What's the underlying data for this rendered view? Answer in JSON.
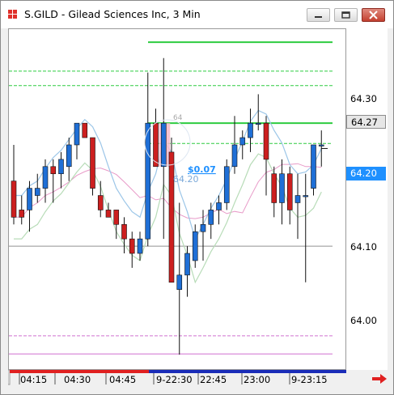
{
  "window": {
    "title": "S.GILD - Gilead Sciences Inc, 3 Min",
    "controls": [
      "minimize",
      "restore",
      "close"
    ]
  },
  "price_axis": {
    "labels": [
      {
        "text": "64.30",
        "value": 64.3
      },
      {
        "text": "64.10",
        "value": 64.1
      },
      {
        "text": "64.00",
        "value": 64.0
      }
    ],
    "badges": [
      {
        "text": "64.27",
        "value": 64.27,
        "style": "gray"
      },
      {
        "text": "64.20",
        "value": 64.2,
        "style": "blue"
      }
    ]
  },
  "time_axis": {
    "labels": [
      "04:15",
      "04:30",
      "04:45",
      "9-22:30",
      "22:45",
      "23:00",
      "9-23:15"
    ]
  },
  "overlay": {
    "pnl_text": "$0.07",
    "position_price": "64.20",
    "entry_marker": "64"
  },
  "colors": {
    "up_candle": "#1f6fd6",
    "down_candle": "#cc1f1f",
    "bb_band": "#9cc6e8",
    "ma_pink": "#e89ac8",
    "ma_green": "#b8dcb8",
    "level_green": "#2ecc40",
    "level_pink": "#d070d0",
    "timebar_red": "#e02020",
    "timebar_blue": "#1a2cb8"
  },
  "chart_data": {
    "type": "candlestick",
    "symbol": "S.GILD",
    "interval": "3 Min",
    "ylim": [
      63.93,
      64.4
    ],
    "candles": [
      {
        "o": 64.19,
        "h": 64.24,
        "l": 64.13,
        "c": 64.14
      },
      {
        "o": 64.15,
        "h": 64.17,
        "l": 64.13,
        "c": 64.14
      },
      {
        "o": 64.15,
        "h": 64.19,
        "l": 64.12,
        "c": 64.18
      },
      {
        "o": 64.17,
        "h": 64.2,
        "l": 64.16,
        "c": 64.18
      },
      {
        "o": 64.18,
        "h": 64.22,
        "l": 64.16,
        "c": 64.21
      },
      {
        "o": 64.21,
        "h": 64.22,
        "l": 64.16,
        "c": 64.2
      },
      {
        "o": 64.2,
        "h": 64.23,
        "l": 64.18,
        "c": 64.22
      },
      {
        "o": 64.21,
        "h": 64.25,
        "l": 64.19,
        "c": 64.24
      },
      {
        "o": 64.24,
        "h": 64.27,
        "l": 64.22,
        "c": 64.27
      },
      {
        "o": 64.27,
        "h": 64.27,
        "l": 64.25,
        "c": 64.25
      },
      {
        "o": 64.25,
        "h": 64.25,
        "l": 64.17,
        "c": 64.18
      },
      {
        "o": 64.17,
        "h": 64.19,
        "l": 64.14,
        "c": 64.15
      },
      {
        "o": 64.15,
        "h": 64.16,
        "l": 64.14,
        "c": 64.14
      },
      {
        "o": 64.15,
        "h": 64.15,
        "l": 64.11,
        "c": 64.13
      },
      {
        "o": 64.13,
        "h": 64.14,
        "l": 64.09,
        "c": 64.11
      },
      {
        "o": 64.11,
        "h": 64.12,
        "l": 64.07,
        "c": 64.09
      },
      {
        "o": 64.09,
        "h": 64.12,
        "l": 64.08,
        "c": 64.11
      },
      {
        "o": 64.11,
        "h": 64.34,
        "l": 64.1,
        "c": 64.27
      },
      {
        "o": 64.27,
        "h": 64.29,
        "l": 64.21,
        "c": 64.21
      },
      {
        "o": 64.21,
        "h": 64.36,
        "l": 64.11,
        "c": 64.27
      },
      {
        "o": 64.23,
        "h": 64.25,
        "l": 64.05,
        "c": 64.05
      },
      {
        "o": 64.04,
        "h": 64.16,
        "l": 63.95,
        "c": 64.06
      },
      {
        "o": 64.06,
        "h": 64.1,
        "l": 64.03,
        "c": 64.09
      },
      {
        "o": 64.08,
        "h": 64.13,
        "l": 64.07,
        "c": 64.12
      },
      {
        "o": 64.12,
        "h": 64.15,
        "l": 64.08,
        "c": 64.13
      },
      {
        "o": 64.13,
        "h": 64.16,
        "l": 64.11,
        "c": 64.15
      },
      {
        "o": 64.15,
        "h": 64.17,
        "l": 64.13,
        "c": 64.16
      },
      {
        "o": 64.16,
        "h": 64.22,
        "l": 64.15,
        "c": 64.21
      },
      {
        "o": 64.21,
        "h": 64.28,
        "l": 64.2,
        "c": 64.24
      },
      {
        "o": 64.24,
        "h": 64.26,
        "l": 64.22,
        "c": 64.25
      },
      {
        "o": 64.25,
        "h": 64.29,
        "l": 64.23,
        "c": 64.27
      },
      {
        "o": 64.27,
        "h": 64.31,
        "l": 64.26,
        "c": 64.27
      },
      {
        "o": 64.27,
        "h": 64.28,
        "l": 64.17,
        "c": 64.22
      },
      {
        "o": 64.2,
        "h": 64.21,
        "l": 64.14,
        "c": 64.16
      },
      {
        "o": 64.16,
        "h": 64.22,
        "l": 64.13,
        "c": 64.2
      },
      {
        "o": 64.2,
        "h": 64.21,
        "l": 64.13,
        "c": 64.15
      },
      {
        "o": 64.16,
        "h": 64.2,
        "l": 64.11,
        "c": 64.17
      },
      {
        "o": 64.17,
        "h": 64.2,
        "l": 64.05,
        "c": 64.17
      },
      {
        "o": 64.18,
        "h": 64.24,
        "l": 64.17,
        "c": 64.24
      },
      {
        "o": 64.24,
        "h": 64.26,
        "l": 64.21,
        "c": 64.24
      }
    ],
    "levels": [
      {
        "value": 64.382,
        "style": "solid",
        "color": "green"
      },
      {
        "value": 64.27,
        "style": "solid",
        "color": "green"
      },
      {
        "value": 64.342,
        "style": "dashed",
        "color": "green"
      },
      {
        "value": 64.322,
        "style": "dashed",
        "color": "green"
      },
      {
        "value": 64.242,
        "style": "dashed",
        "color": "green"
      },
      {
        "value": 64.1,
        "style": "solid",
        "color": "gray"
      },
      {
        "value": 63.976,
        "style": "dashed",
        "color": "pink"
      },
      {
        "value": 63.951,
        "style": "solid",
        "color": "pink"
      }
    ],
    "grid": false
  }
}
